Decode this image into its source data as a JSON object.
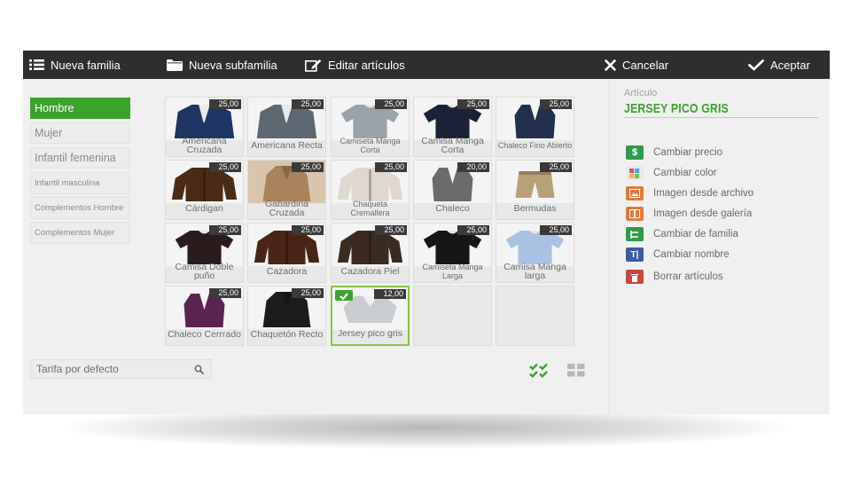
{
  "toolbar": {
    "nueva_familia": "Nueva familia",
    "nueva_subfamilia": "Nueva subfamilia",
    "editar_articulos": "Editar artículos",
    "cancelar": "Cancelar",
    "aceptar": "Aceptar"
  },
  "families": [
    {
      "label": "Hombre",
      "active": true
    },
    {
      "label": "Mujer",
      "active": false
    },
    {
      "label": "Infantil femenina",
      "active": false
    },
    {
      "label": "Infantil masculina",
      "active": false
    },
    {
      "label": "Complementos Hombre",
      "active": false
    },
    {
      "label": "Complementos Mujer",
      "active": false
    }
  ],
  "articles": [
    {
      "name": "Americana Cruzada",
      "price": "25,00",
      "icon": "blazer-navy-image"
    },
    {
      "name": "Americana Recta",
      "price": "25,00",
      "icon": "blazer-grey-image"
    },
    {
      "name": "Camiseta Manga Corta",
      "price": "25,00",
      "icon": "tshirt-print-image"
    },
    {
      "name": "Camisa Manga Corta",
      "price": "25,00",
      "icon": "shirt-navy-image"
    },
    {
      "name": "Chaleco Fino Abierto",
      "price": "25,00",
      "icon": "vest-navy-image"
    },
    {
      "name": "Cárdigan",
      "price": "25,00",
      "icon": "cardigan-brown-image"
    },
    {
      "name": "Gabardina Cruzada",
      "price": "25,00",
      "icon": "trench-coat-image"
    },
    {
      "name": "Chaqueta Cremallera",
      "price": "25,00",
      "icon": "zip-jacket-image"
    },
    {
      "name": "Chaleco",
      "price": "20,00",
      "icon": "vest-grey-image"
    },
    {
      "name": "Bermudas",
      "price": "25,00",
      "icon": "shorts-khaki-image"
    },
    {
      "name": "Camisa Doble puño",
      "price": "25,00",
      "icon": "shirt-dark-image"
    },
    {
      "name": "Cazadora",
      "price": "25,00",
      "icon": "leather-jacket-image"
    },
    {
      "name": "Cazadora Piel",
      "price": "25,00",
      "icon": "leather-jacket-dark-image"
    },
    {
      "name": "Camiseta Manga Larga",
      "price": "25,00",
      "icon": "longsleeve-black-image"
    },
    {
      "name": "Camisa Manga larga",
      "price": "25,00",
      "icon": "shirt-lightblue-image"
    },
    {
      "name": "Chaleco Cerrrado",
      "price": "25,00",
      "icon": "vest-purple-image"
    },
    {
      "name": "Chaquetón Recto",
      "price": "25,00",
      "icon": "coat-black-image"
    },
    {
      "name": "Jersey pico gris",
      "price": "12,00",
      "icon": "sweater-grey-image",
      "selected": true
    }
  ],
  "tarifa": {
    "label": "Tarifa por defecto"
  },
  "panel": {
    "articulo_label": "Artículo",
    "articulo_name": "JERSEY PICO GRIS",
    "actions": [
      {
        "label": "Cambiar precio",
        "icon": "dollar-icon",
        "color": "#2e9c4a"
      },
      {
        "label": "Cambiar color",
        "icon": "palette-icon",
        "color": "#e8e8e8"
      },
      {
        "label": "Imagen desde archivo",
        "icon": "image-file-icon",
        "color": "#e07b3c"
      },
      {
        "label": "Imagen desde galería",
        "icon": "gallery-icon",
        "color": "#e07b3c"
      },
      {
        "label": "Cambiar de familia",
        "icon": "family-tree-icon",
        "color": "#2e9c4a"
      },
      {
        "label": "Cambiar nombre",
        "icon": "rename-icon",
        "color": "#3b5aa8"
      },
      {
        "label": "Borrar artículos",
        "icon": "trash-icon",
        "color": "#c94a3c"
      }
    ]
  },
  "colors": {
    "accent": "#3ba32c",
    "toolbar": "#2e2e2e",
    "price_tag": "#3a3a3a"
  }
}
